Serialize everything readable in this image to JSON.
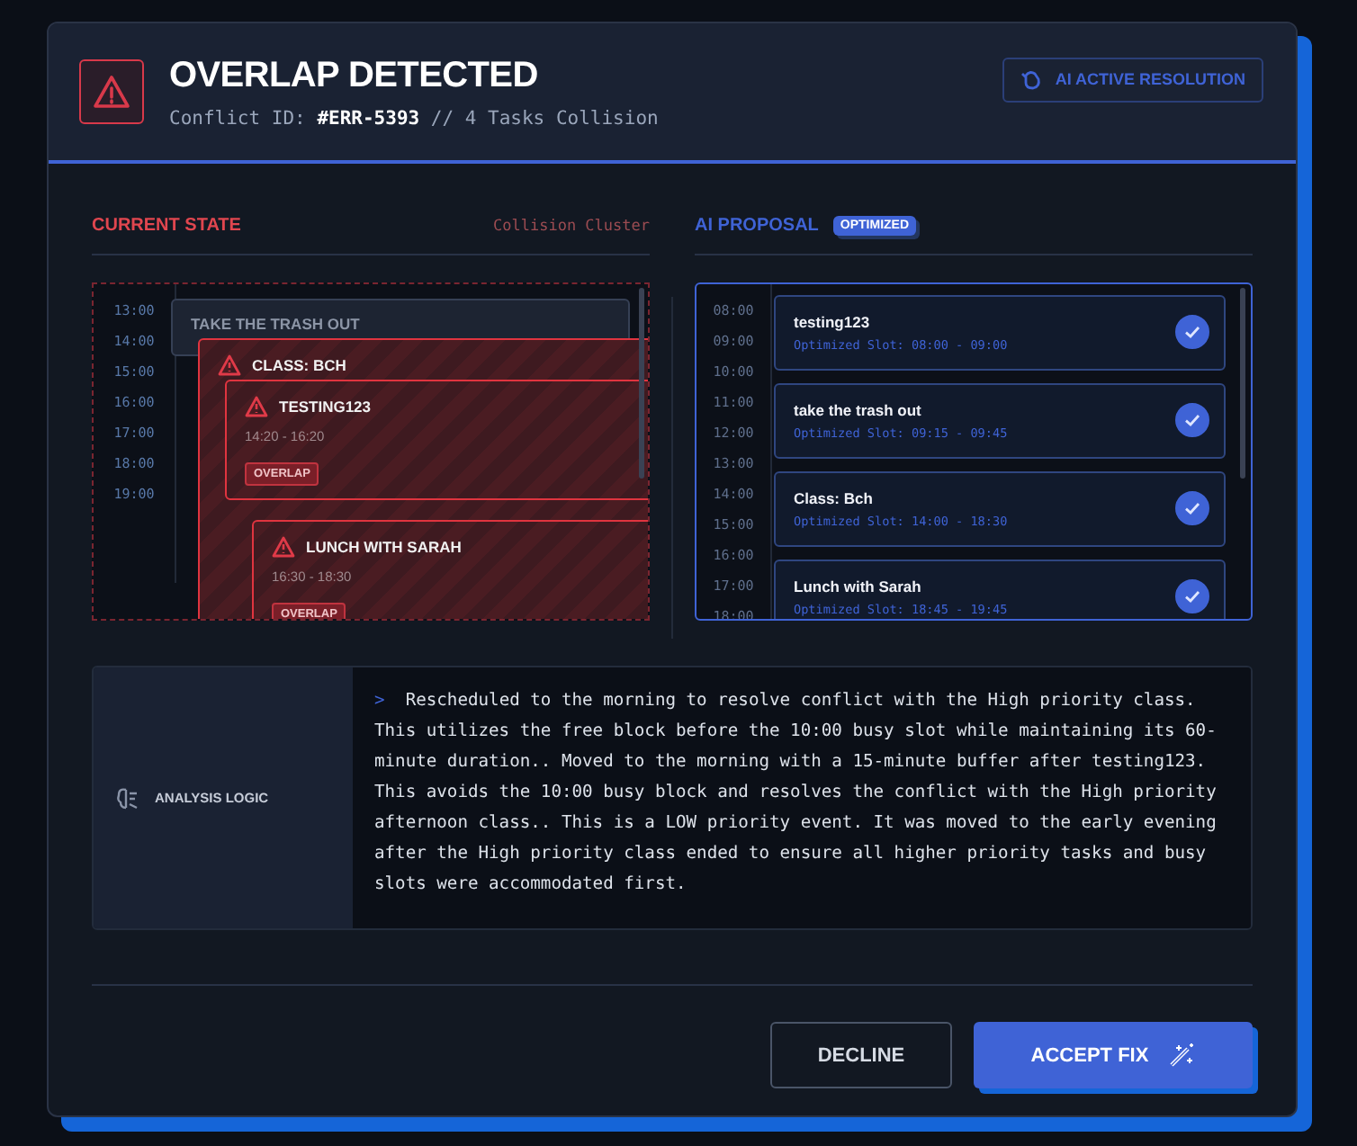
{
  "header": {
    "title": "OVERLAP DETECTED",
    "subtitle": "Conflict ID: **#ERR-5393** // 4 Tasks Collision",
    "badge": "AI ACTIVE RESOLUTION"
  },
  "current_state": {
    "title": "CURRENT STATE",
    "note": "Collision Cluster",
    "hours": [
      "13:00",
      "14:00",
      "15:00",
      "16:00",
      "17:00",
      "18:00",
      "19:00"
    ],
    "events": [
      {
        "kind": "normal",
        "title": "TAKE THE TRASH OUT"
      },
      {
        "kind": "conflict",
        "title": "CLASS: BCH"
      },
      {
        "kind": "conflict",
        "title": "TESTING123",
        "time": "14:20 - 16:20",
        "badge": "OVERLAP"
      },
      {
        "kind": "conflict",
        "title": "LUNCH WITH SARAH",
        "time": "16:30 - 18:30",
        "badge": "OVERLAP"
      }
    ]
  },
  "ai_proposal": {
    "title": "AI PROPOSAL",
    "badge": "OPTIMIZED",
    "hours": [
      "08:00",
      "09:00",
      "10:00",
      "11:00",
      "12:00",
      "13:00",
      "14:00",
      "15:00",
      "16:00",
      "17:00",
      "18:00"
    ],
    "items": [
      {
        "title": "testing123",
        "slot": "Optimized Slot: 08:00 - 09:00",
        "checked": true
      },
      {
        "title": "take the trash out",
        "slot": "Optimized Slot: 09:15 - 09:45",
        "checked": true
      },
      {
        "title": "Class: Bch",
        "slot": "Optimized Slot: 14:00 - 18:30",
        "checked": true
      },
      {
        "title": "Lunch with Sarah",
        "slot": "Optimized Slot: 18:45 - 19:45",
        "checked": true
      }
    ]
  },
  "analysis": {
    "label": "ANALYSIS LOGIC",
    "prompt": ">",
    "text": "Rescheduled to the morning to resolve conflict with the High priority class. This utilizes the free block before the 10:00 busy slot while maintaining its 60-minute duration.. Moved to the morning with a 15-minute buffer after testing123. This avoids the 10:00 busy block and resolves the conflict with the High priority afternoon class.. This is a LOW priority event. It was moved to the early evening after the High priority class ended to ensure all higher priority tasks and busy slots were accommodated first."
  },
  "buttons": [
    {
      "kind": "secondary",
      "label": "DECLINE"
    },
    {
      "kind": "primary",
      "label": "ACCEPT FIX"
    }
  ]
}
